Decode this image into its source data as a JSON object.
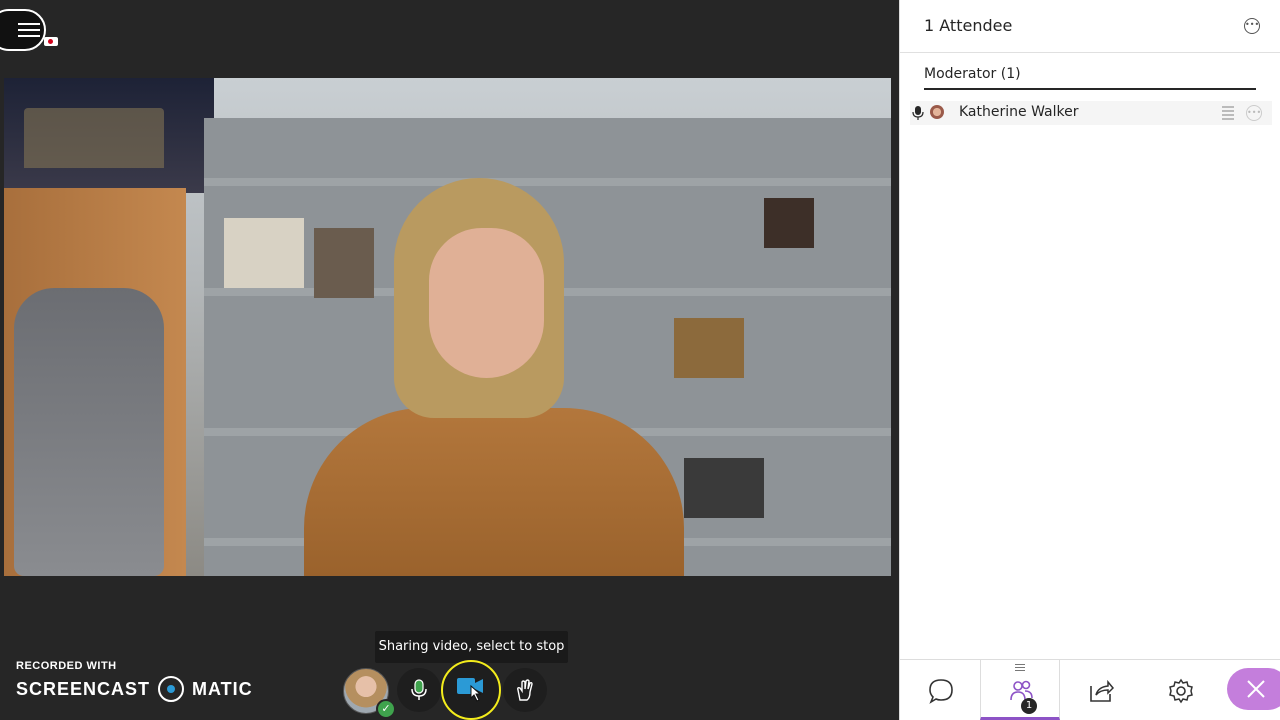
{
  "video": {
    "tooltip": "Sharing video, select to stop"
  },
  "watermark": {
    "line1": "RECORDED WITH",
    "word_left": "SCREENCAST",
    "word_right": "MATIC"
  },
  "panel": {
    "title": "1 Attendee",
    "section": "Moderator (1)",
    "attendees": [
      {
        "name": "Katherine Walker"
      }
    ]
  },
  "tabs": {
    "attendees_badge": "1"
  },
  "colors": {
    "accent": "#8d53c6",
    "close": "#c47edc",
    "highlight": "#f3ec1c",
    "camera": "#2b9ad6"
  },
  "icons": {
    "menu": "hamburger-icon",
    "record": "video-recording-icon",
    "mic": "microphone-icon",
    "camera": "camera-icon",
    "hand": "raise-hand-icon",
    "chat": "chat-bubble-icon",
    "attendees": "people-icon",
    "share": "share-content-icon",
    "settings": "gear-icon",
    "close": "close-icon"
  }
}
